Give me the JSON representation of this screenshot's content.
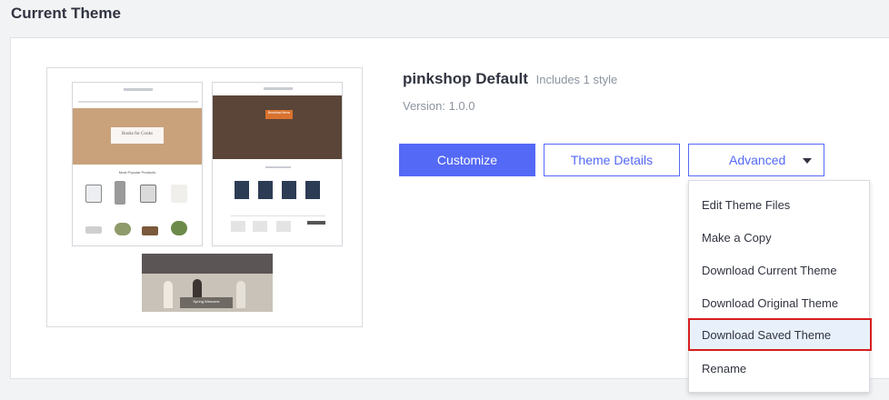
{
  "section": {
    "title": "Current Theme"
  },
  "theme": {
    "name": "pinkshop Default",
    "styles_note": "Includes 1 style",
    "version": "Version: 1.0.0",
    "preview_labels": {
      "thumb1_hero": "Books for Cooks",
      "thumb1_heading": "Most Popular Products",
      "thumb2_hero": "Breakfast Items",
      "thumb3_banner": "Spring Welcome"
    }
  },
  "actions": {
    "customize": "Customize",
    "details": "Theme Details",
    "advanced": "Advanced"
  },
  "advanced_menu": {
    "items": [
      "Edit Theme Files",
      "Make a Copy",
      "Download Current Theme",
      "Download Original Theme",
      "Download Saved Theme",
      "Rename"
    ],
    "highlighted_index": 4
  },
  "colors": {
    "accent": "#5469f5",
    "highlight_border": "#d81e1e",
    "highlight_bg": "#e8f1fb"
  }
}
